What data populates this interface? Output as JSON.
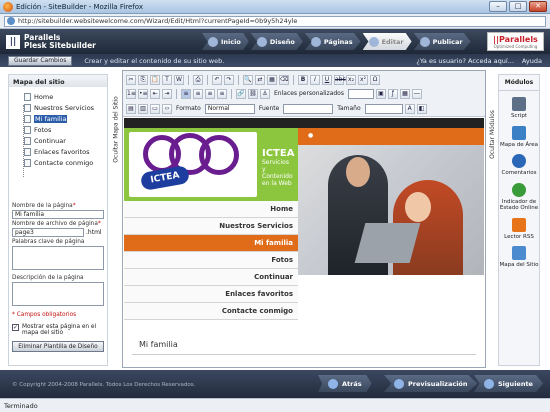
{
  "window": {
    "title": "Edición - SiteBuilder - Mozilla Firefox",
    "url": "http://sitebuilder.websitewelcome.com/Wizard/Edit/Html?currentPageId=0b9y5h24yle"
  },
  "brand": {
    "line1": "Parallels",
    "line2": "Plesk Sitebuilder",
    "badge": "||Parallels",
    "badge_sub": "Optimized Computing"
  },
  "steps": [
    {
      "label": "Inicio"
    },
    {
      "label": "Diseño"
    },
    {
      "label": "Páginas"
    },
    {
      "label": "Editar"
    },
    {
      "label": "Publicar"
    }
  ],
  "subbar": {
    "save_label": "Guardar Cambios",
    "hint": "Crear y editar el contenido de su sitio web.",
    "user_prompt": "¿Ya es usuario? Acceda aquí...",
    "help": "Ayuda"
  },
  "sitemap": {
    "title": "Mapa del sitio",
    "pages": [
      "Home",
      "Nuestros Servicios",
      "Mi familia",
      "Fotos",
      "Continuar",
      "Enlaces favoritos",
      "Contacte conmigo"
    ],
    "selected_index": 2
  },
  "props": {
    "name_label": "Nombre de la página",
    "name_value": "Mi familia",
    "file_label": "Nombre de archivo de página",
    "file_value": "page3",
    "file_ext": ".html",
    "keywords_label": "Palabras clave de página",
    "desc_label": "Descripción de la página",
    "required_note": "* Campos obligatorios",
    "show_in_map": "Mostrar esta página en el mapa del sitio",
    "delete_button": "Eliminar Plantilla de Diseño"
  },
  "vtabs": {
    "left": "Ocultar Mapa del Sitio",
    "right": "Ocultar Módulos"
  },
  "toolbar": {
    "custom_links": "Enlaces personalizados",
    "format_label": "Formato",
    "format_value": "Normal",
    "font_label": "Fuente",
    "size_label": "Tamaño"
  },
  "site": {
    "title": "ICTEA",
    "subtitle": "Servicios y Contenido en la Web",
    "logo_word": "ICTEA",
    "nav": [
      "Home",
      "Nuestros Servicios",
      "Mi familia",
      "Fotos",
      "Continuar",
      "Enlaces favoritos",
      "Contacte conmigo"
    ],
    "active_nav_index": 2,
    "page_heading": "Mi familia"
  },
  "modules": {
    "title": "Módulos",
    "items": [
      {
        "label": "Script",
        "icon": "script-icon",
        "color": "#5d6f86"
      },
      {
        "label": "Mapa de Área",
        "icon": "area-map-icon",
        "color": "#3b7fc4"
      },
      {
        "label": "Comentarios",
        "icon": "comments-icon",
        "color": "#2b67b7"
      },
      {
        "label": "Indicador de Estado Online",
        "icon": "online-status-icon",
        "color": "#3a9b3a"
      },
      {
        "label": "Lector RSS",
        "icon": "rss-icon",
        "color": "#e8741a"
      },
      {
        "label": "Mapa del Sitio",
        "icon": "sitemap-icon",
        "color": "#4c8ad0"
      }
    ]
  },
  "footer": {
    "copyright": "© Copyright 2004-2008 Parallels. Todos Los Derechos Reservados.",
    "back": "Atrás",
    "preview": "Previsualización",
    "next": "Siguiente"
  },
  "status": "Terminado",
  "colors": {
    "accent_orange": "#e06c1a",
    "header_green": "#8cc63f",
    "logo_purple": "#6a1d8f",
    "logo_blue": "#1d3e9e"
  }
}
